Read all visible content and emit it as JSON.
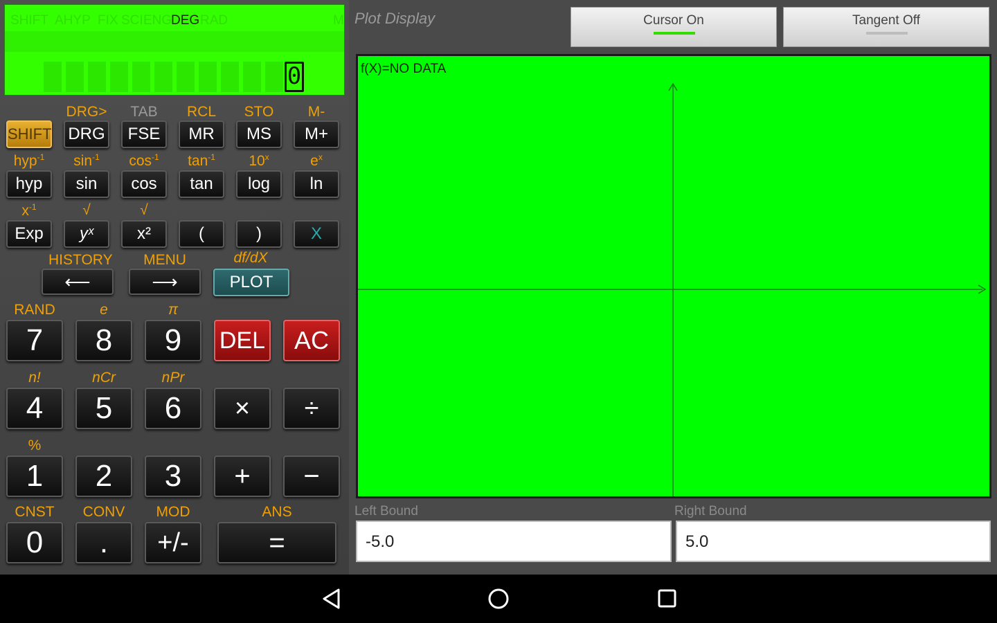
{
  "lcd": {
    "indicators": [
      "SHIFT",
      "AHYP",
      "FIX",
      "SCI",
      "ENG",
      "DEG",
      "RAD",
      "M"
    ],
    "active_indicator": "DEG",
    "display_value": "0"
  },
  "row1_labels": [
    "DRG>",
    "TAB",
    "RCL",
    "STO",
    "M-"
  ],
  "row1_keys": [
    "SHIFT",
    "DRG",
    "FSE",
    "MR",
    "MS",
    "M+"
  ],
  "row2_labels": [
    "hyp",
    "sin",
    "cos",
    "tan",
    "10",
    "e"
  ],
  "row2_sups": [
    "-1",
    "-1",
    "-1",
    "-1",
    "x",
    "x"
  ],
  "row2_keys": [
    "hyp",
    "sin",
    "cos",
    "tan",
    "log",
    "ln"
  ],
  "row3_labels": [
    "x",
    "√",
    "√"
  ],
  "row3_keys": [
    "Exp",
    "yˣ",
    "x²",
    "(",
    ")",
    "X"
  ],
  "nav": {
    "history": "HISTORY",
    "menu": "MENU",
    "deriv": "df/dX",
    "back": "⟵",
    "forward": "⟶",
    "plot": "PLOT"
  },
  "num_labels": {
    "r1": [
      "RAND",
      "e",
      "π"
    ],
    "r2": [
      "n!",
      "nCr",
      "nPr"
    ],
    "r3": [
      "%"
    ],
    "r4": [
      "CNST",
      "CONV",
      "MOD",
      "ANS"
    ]
  },
  "num_keys": {
    "r1": [
      "7",
      "8",
      "9",
      "DEL",
      "AC"
    ],
    "r2": [
      "4",
      "5",
      "6",
      "×",
      "÷"
    ],
    "r3": [
      "1",
      "2",
      "3",
      "+",
      "−"
    ],
    "r4": [
      "0",
      ".",
      "+/-",
      "="
    ]
  },
  "plot": {
    "title": "Plot Display",
    "cursor_button": "Cursor On",
    "tangent_button": "Tangent Off",
    "function_text": "f(X)=NO DATA",
    "left_bound_label": "Left Bound",
    "right_bound_label": "Right Bound",
    "left_bound": "-5.0",
    "right_bound": "5.0"
  },
  "colors": {
    "lcd": "#33ff00",
    "plot_bg": "#00ff00",
    "shift_label": "#f0a000",
    "del_key": "#c81e1e",
    "plot_key": "#2f6a6e",
    "cursor_on_bar": "#33dd00"
  },
  "icons": [
    "back-icon",
    "home-icon",
    "recents-icon"
  ]
}
